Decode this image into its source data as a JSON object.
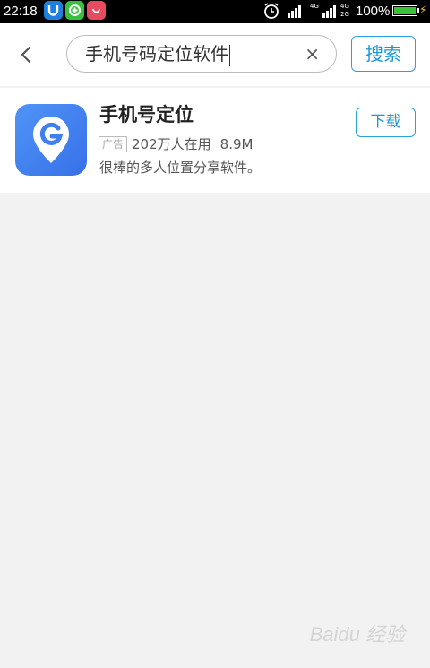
{
  "status_bar": {
    "time": "22:18",
    "network_top": "4G",
    "network_top2": "4G",
    "network_bottom": "2G",
    "battery_percent": "100%",
    "battery_level": 1.0,
    "notification_icons": [
      "blue-app-icon",
      "green-app-icon",
      "shopping-bag-icon"
    ]
  },
  "search": {
    "query": "手机号码定位软件",
    "button_label": "搜索"
  },
  "result": {
    "app_name": "手机号定位",
    "ad_label": "广告",
    "users": "202万人在用",
    "size": "8.9M",
    "description": "很棒的多人位置分享软件。",
    "download_label": "下载"
  },
  "colors": {
    "accent": "#1b96d8",
    "app_icon": "#4a8ff5",
    "background": "#f2f2f2"
  },
  "watermark": "Baidu 经验"
}
